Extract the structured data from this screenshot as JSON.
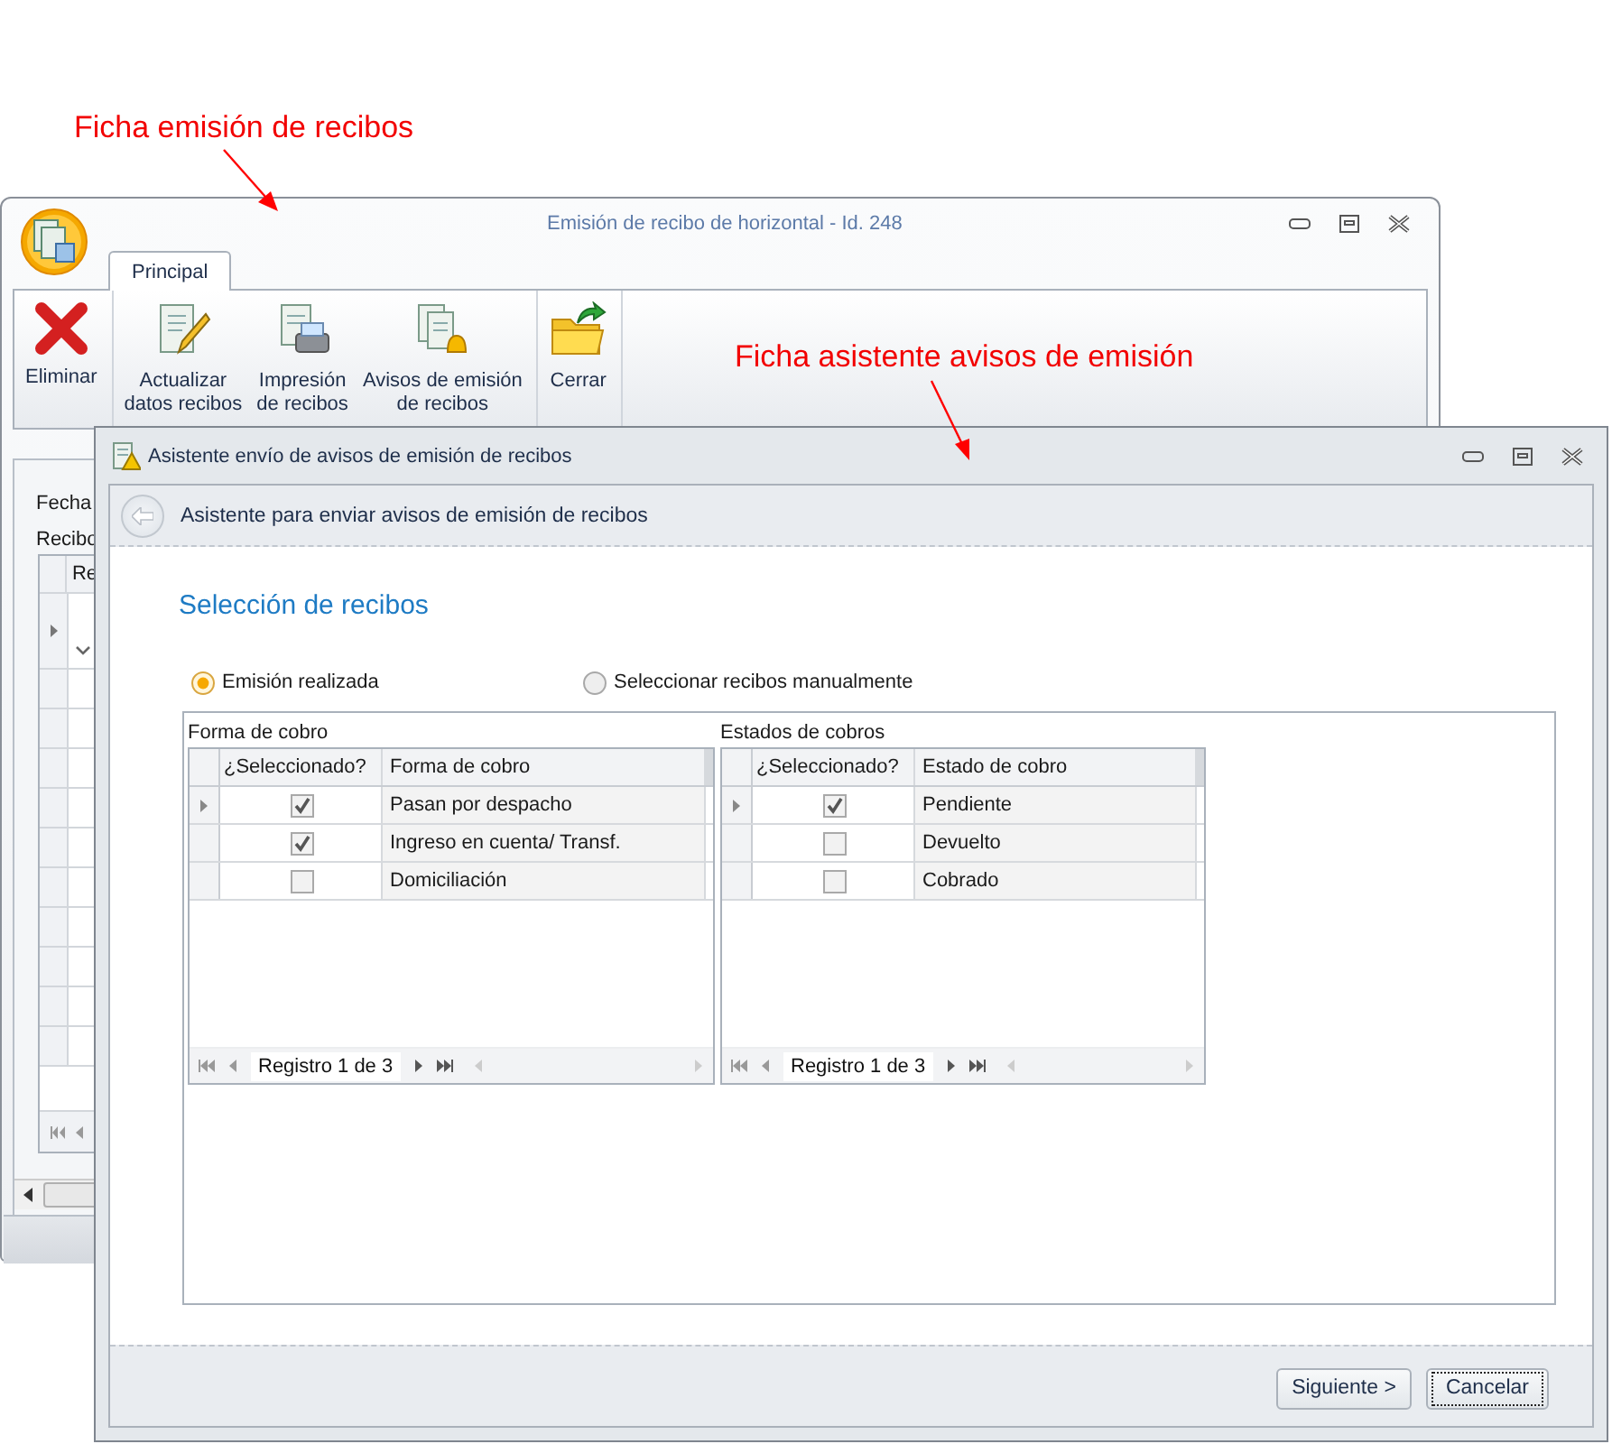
{
  "annotations": [
    {
      "text": "Ficha emisión de recibos"
    },
    {
      "text": "Ficha asistente avisos de emisión"
    }
  ],
  "main_window": {
    "title": "Emisión de recibo de horizontal - Id. 248",
    "tabs": [
      {
        "label": "Principal",
        "selected": true
      }
    ],
    "ribbon_groups": [
      {
        "items": [
          {
            "kind": "delete",
            "lines": [
              "Eliminar"
            ]
          }
        ]
      },
      {
        "items": [
          {
            "kind": "edit",
            "lines": [
              "Actualizar",
              "datos recibos"
            ]
          },
          {
            "kind": "print",
            "lines": [
              "Impresión",
              "de recibos"
            ]
          },
          {
            "kind": "alert",
            "lines": [
              "Avisos de emisión",
              "de recibos"
            ]
          }
        ]
      },
      {
        "items": [
          {
            "kind": "open",
            "lines": [
              "Cerrar"
            ]
          }
        ]
      }
    ],
    "labels": [
      "Fecha",
      "Recibo"
    ],
    "grid_header": "Re"
  },
  "wizard": {
    "title": "Asistente envío de avisos de emisión de recibos",
    "header": "Asistente para enviar avisos de emisión de recibos",
    "section_title": "Selección de recibos",
    "radios": [
      {
        "label": "Emisión realizada",
        "selected": true
      },
      {
        "label": "Seleccionar recibos manualmente",
        "selected": false
      }
    ],
    "grids": [
      {
        "caption": "Forma de cobro",
        "columns": [
          "¿Seleccionado?",
          "Forma de cobro"
        ],
        "pager": "Registro 1 de 3",
        "rows": [
          {
            "current": true,
            "checked": true,
            "label": "Pasan por despacho"
          },
          {
            "current": false,
            "checked": true,
            "label": "Ingreso en cuenta/ Transf."
          },
          {
            "current": false,
            "checked": false,
            "label": "Domiciliación"
          }
        ]
      },
      {
        "caption": "Estados de cobros",
        "columns": [
          "¿Seleccionado?",
          "Estado de cobro"
        ],
        "pager": "Registro 1 de 3",
        "rows": [
          {
            "current": true,
            "checked": true,
            "label": "Pendiente"
          },
          {
            "current": false,
            "checked": false,
            "label": "Devuelto"
          },
          {
            "current": false,
            "checked": false,
            "label": "Cobrado"
          }
        ]
      }
    ],
    "buttons": [
      {
        "label": "Siguiente >",
        "focused": false
      },
      {
        "label": "Cancelar",
        "focused": true
      }
    ]
  }
}
